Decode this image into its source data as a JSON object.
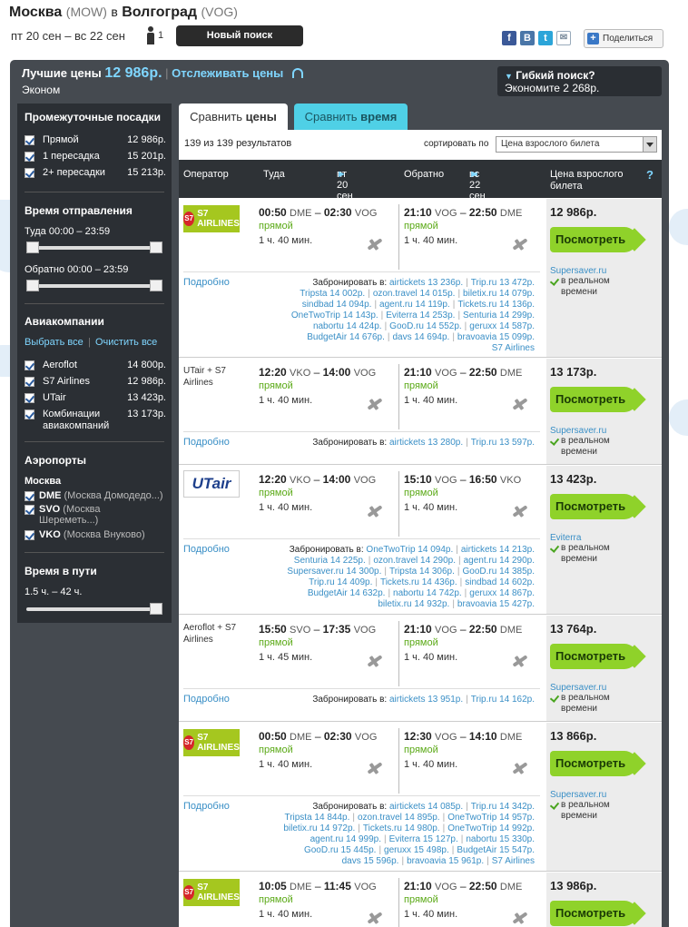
{
  "header": {
    "from": "Москва",
    "from_code": "(MOW)",
    "conj": "в",
    "to": "Волгоград",
    "to_code": "(VOG)",
    "dates": "пт 20 сен – вс 22 сен",
    "pax": "1",
    "new_search": "Новый поиск",
    "share": "Поделиться"
  },
  "social": {
    "fb": "f",
    "vk": "B",
    "tw": "t",
    "mail": "✉",
    "share_plus": "+"
  },
  "summary": {
    "best_label": "Лучшие цены",
    "best_price": "12 986р.",
    "sep": "|",
    "track": "Отслеживать цены",
    "class": "Эконом",
    "flex_title": "Гибкий поиск?",
    "flex_tri": "▼",
    "flex_save": "Экономите 2 268р."
  },
  "sidebar": {
    "stops_title": "Промежуточные посадки",
    "stops": [
      {
        "label": "Прямой",
        "value": "12 986р."
      },
      {
        "label": "1 пересадка",
        "value": "15 201р."
      },
      {
        "label": "2+ пересадки",
        "value": "15 213р."
      }
    ],
    "dep_title": "Время отправления",
    "dep_there": "Туда 00:00 – 23:59",
    "dep_back": "Обратно 00:00 – 23:59",
    "airlines_title": "Авиакомпании",
    "select_all": "Выбрать все",
    "sep": "|",
    "clear_all": "Очистить все",
    "airlines": [
      {
        "label": "Aeroflot",
        "value": "14 800р."
      },
      {
        "label": "S7 Airlines",
        "value": "12 986р."
      },
      {
        "label": "UTair",
        "value": "13 423р."
      },
      {
        "label": "Комбинации авиакомпаний",
        "value": "13 173р."
      }
    ],
    "airports_title": "Аэропорты",
    "airports_city": "Москва",
    "airports": [
      {
        "code": "DME",
        "name": "(Москва Домодедо...)"
      },
      {
        "code": "SVO",
        "name": "(Москва Шереметь...)"
      },
      {
        "code": "VKO",
        "name": "(Москва Внуково)"
      }
    ],
    "travel_title": "Время в пути",
    "travel_range": "1.5 ч. – 42 ч."
  },
  "tabs": {
    "price_pre": "Сравнить ",
    "price_b": "цены",
    "time_pre": "Сравнить ",
    "time_b": "время"
  },
  "results": {
    "count": "139 из 139 результатов",
    "sort_label": "сортировать по",
    "sort_value": "Цена взрослого билета"
  },
  "table_head": {
    "operator": "Оператор",
    "there": "Туда",
    "there_date": "пт 20 сен",
    "back": "Обратно",
    "back_date": "вс 22 сен",
    "price": "Цена взрослого билета",
    "q": "?",
    "arrow_r": "►",
    "arrow_l": "◄"
  },
  "common": {
    "direct": "прямой",
    "see": "Посмотреть",
    "more": "Подробно",
    "book": "Забронировать в:",
    "realtime": "в реальном времени",
    "dash": "–"
  },
  "cards": [
    {
      "op": "S7 AIRLINES",
      "logo": "s7",
      "dep": "00:50",
      "dep_ap": "DME",
      "arr": "02:30",
      "arr_ap": "VOG",
      "dur": "1 ч. 40 мин.",
      "rdep": "21:10",
      "rdep_ap": "VOG",
      "rarr": "22:50",
      "rarr_ap": "DME",
      "rdur": "1 ч. 40 мин.",
      "price": "12 986р.",
      "agent": "Supersaver.ru",
      "lines": [
        [
          "airtickets 13 236р.",
          "Trip.ru 13 472р."
        ],
        [
          "Tripsta 14 002р.",
          "ozon.travel 14 015р.",
          "biletix.ru 14 079р."
        ],
        [
          "sindbad 14 094р.",
          "agent.ru 14 119р.",
          "Tickets.ru 14 136р."
        ],
        [
          "OneTwoTrip 14 143р.",
          "Eviterra 14 253р.",
          "Senturia 14 299р."
        ],
        [
          "nabortu 14 424р.",
          "GooD.ru 14 552р.",
          "geruxx 14 587р."
        ],
        [
          "BudgetAir 14 676р.",
          "davs 14 694р.",
          "bravoavia 15 099р."
        ],
        [
          "S7 Airlines"
        ]
      ]
    },
    {
      "op": "UTair + S7 Airlines",
      "logo": "text",
      "dep": "12:20",
      "dep_ap": "VKO",
      "arr": "14:00",
      "arr_ap": "VOG",
      "dur": "1 ч. 40 мин.",
      "rdep": "21:10",
      "rdep_ap": "VOG",
      "rarr": "22:50",
      "rarr_ap": "DME",
      "rdur": "1 ч. 40 мин.",
      "price": "13 173р.",
      "agent": "Supersaver.ru",
      "lines": [
        [
          "airtickets 13 280р.",
          "Trip.ru 13 597р."
        ]
      ]
    },
    {
      "op": "UTair",
      "logo": "ut",
      "dep": "12:20",
      "dep_ap": "VKO",
      "arr": "14:00",
      "arr_ap": "VOG",
      "dur": "1 ч. 40 мин.",
      "rdep": "15:10",
      "rdep_ap": "VOG",
      "rarr": "16:50",
      "rarr_ap": "VKO",
      "rdur": "1 ч. 40 мин.",
      "price": "13 423р.",
      "agent": "Eviterra",
      "lines": [
        [
          "OneTwoTrip 14 094р.",
          "airtickets 14 213р."
        ],
        [
          "Senturia 14 225р.",
          "ozon.travel 14 290р.",
          "agent.ru 14 290р."
        ],
        [
          "Supersaver.ru 14 300р.",
          "Tripsta 14 306р.",
          "GooD.ru 14 385р."
        ],
        [
          "Trip.ru 14 409р.",
          "Tickets.ru 14 436р.",
          "sindbad 14 602р."
        ],
        [
          "BudgetAir 14 632р.",
          "nabortu 14 742р.",
          "geruxx 14 867р."
        ],
        [
          "biletix.ru 14 932р.",
          "bravoavia 15 427р."
        ]
      ]
    },
    {
      "op": "Aeroflot + S7 Airlines",
      "logo": "text",
      "dep": "15:50",
      "dep_ap": "SVO",
      "arr": "17:35",
      "arr_ap": "VOG",
      "dur": "1 ч. 45 мин.",
      "rdep": "21:10",
      "rdep_ap": "VOG",
      "rarr": "22:50",
      "rarr_ap": "DME",
      "rdur": "1 ч. 40 мин.",
      "price": "13 764р.",
      "agent": "Supersaver.ru",
      "lines": [
        [
          "airtickets 13 951р.",
          "Trip.ru 14 162р."
        ]
      ]
    },
    {
      "op": "S7 AIRLINES",
      "logo": "s7",
      "dep": "00:50",
      "dep_ap": "DME",
      "arr": "02:30",
      "arr_ap": "VOG",
      "dur": "1 ч. 40 мин.",
      "rdep": "12:30",
      "rdep_ap": "VOG",
      "rarr": "14:10",
      "rarr_ap": "DME",
      "rdur": "1 ч. 40 мин.",
      "price": "13 866р.",
      "agent": "Supersaver.ru",
      "lines": [
        [
          "airtickets 14 085р.",
          "Trip.ru 14 342р."
        ],
        [
          "Tripsta 14 844р.",
          "ozon.travel 14 895р.",
          "OneTwoTrip 14 957р."
        ],
        [
          "biletix.ru 14 972р.",
          "Tickets.ru 14 980р.",
          "OneTwoTrip 14 992р."
        ],
        [
          "agent.ru 14 999р.",
          "Eviterra 15 127р.",
          "nabortu 15 330р."
        ],
        [
          "GooD.ru 15 445р.",
          "geruxx 15 498р.",
          "BudgetAir 15 547р."
        ],
        [
          "davs 15 596р.",
          "bravoavia 15 961р.",
          "S7 Airlines"
        ]
      ]
    },
    {
      "op": "S7 AIRLINES",
      "logo": "s7",
      "dep": "10:05",
      "dep_ap": "DME",
      "arr": "11:45",
      "arr_ap": "VOG",
      "dur": "1 ч. 40 мин.",
      "rdep": "21:10",
      "rdep_ap": "VOG",
      "rarr": "22:50",
      "rarr_ap": "DME",
      "rdur": "1 ч. 40 мин.",
      "price": "13 986р.",
      "agent": "",
      "lines": []
    }
  ]
}
